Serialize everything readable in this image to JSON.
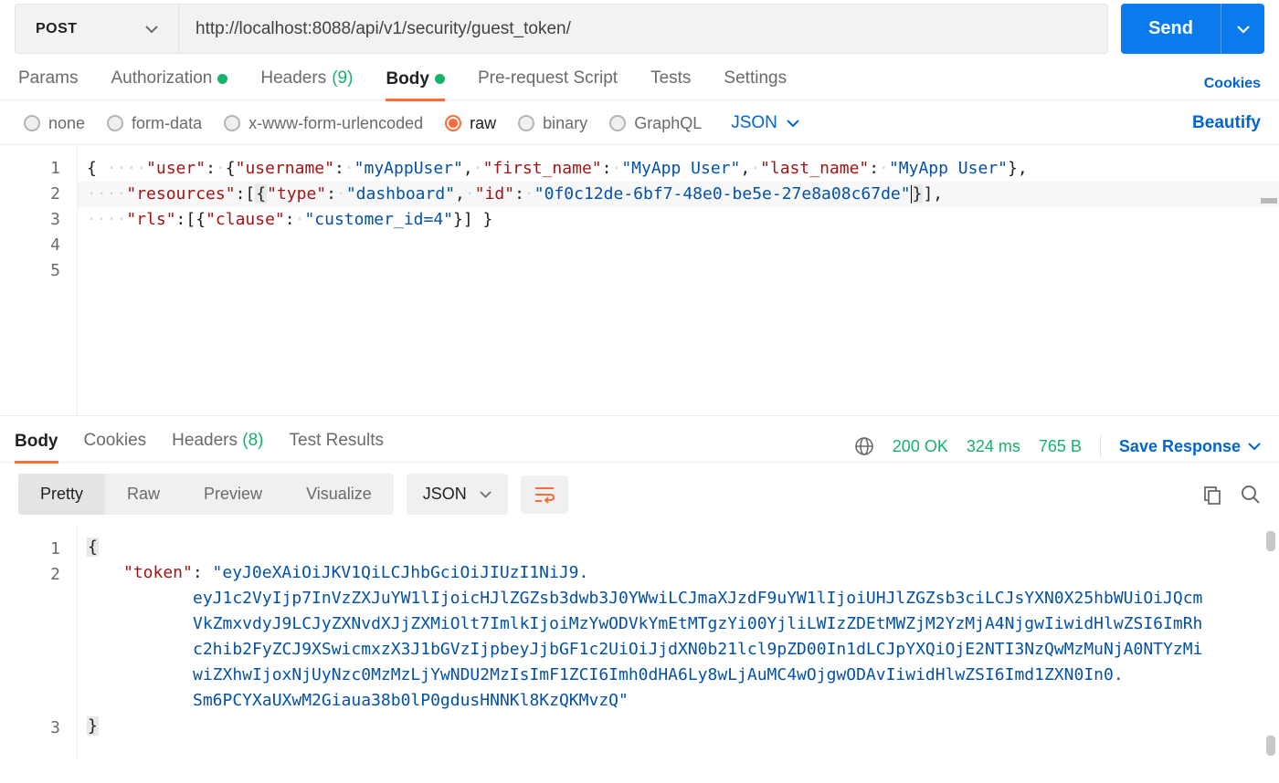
{
  "request": {
    "method": "POST",
    "url": "http://localhost:8088/api/v1/security/guest_token/",
    "send_label": "Send"
  },
  "tabs": {
    "params": "Params",
    "authorization": "Authorization",
    "headers": "Headers",
    "headers_count": "(9)",
    "body": "Body",
    "prerequest": "Pre-request Script",
    "tests": "Tests",
    "settings": "Settings",
    "cookies_link": "Cookies"
  },
  "body_type": {
    "none": "none",
    "formdata": "form-data",
    "xform": "x-www-form-urlencoded",
    "raw": "raw",
    "binary": "binary",
    "graphql": "GraphQL",
    "lang": "JSON",
    "beautify": "Beautify"
  },
  "request_body": {
    "lines": [
      "1",
      "2",
      "3",
      "4",
      "5"
    ],
    "l2": {
      "k_user": "\"user\"",
      "k_username": "\"username\"",
      "v_username": "\"myAppUser\"",
      "k_first": "\"first_name\"",
      "v_first": "\"MyApp User\"",
      "k_last": "\"last_name\"",
      "v_last": "\"MyApp User\""
    },
    "l3": {
      "k_resources": "\"resources\"",
      "k_type": "\"type\"",
      "v_type": "\"dashboard\"",
      "k_id": "\"id\"",
      "v_id": "\"0f0c12de-6bf7-48e0-be5e-27e8a08c67de\""
    },
    "l4": {
      "k_rls": "\"rls\"",
      "k_clause": "\"clause\"",
      "v_clause": "\"customer_id=4\""
    }
  },
  "response": {
    "tabs": {
      "body": "Body",
      "cookies": "Cookies",
      "headers": "Headers",
      "headers_count": "(8)",
      "test": "Test Results"
    },
    "status": "200 OK",
    "time": "324 ms",
    "size": "765 B",
    "save": "Save Response",
    "fmt": {
      "pretty": "Pretty",
      "raw": "Raw",
      "preview": "Preview",
      "visualize": "Visualize",
      "lang": "JSON"
    },
    "lines": [
      "1",
      "2",
      "3"
    ],
    "body": {
      "k_token": "\"token\"",
      "v_token_1": "\"eyJ0eXAiOiJKV1QiLCJhbGciOiJIUzI1NiJ9.",
      "v_token_2": "eyJ1c2VyIjp7InVzZXJuYW1lIjoicHJlZGZsb3dwb3J0YWwiLCJmaXJzdF9uYW1lIjoiUHJlZGZsb3ciLCJsYXN0X25hbWUiOiJQcm",
      "v_token_3": "VkZmxvdyJ9LCJyZXNvdXJjZXMiOlt7ImlkIjoiMzYwODVkYmEtMTgzYi00YjliLWIzZDEtMWZjM2YzMjA4NjgwIiwidHlwZSI6ImRh",
      "v_token_4": "c2hib2FyZCJ9XSwicmxzX3J1bGVzIjpbeyJjbGF1c2UiOiJjdXN0b21lcl9pZD00In1dLCJpYXQiOjE2NTI3NzQwMzMuNjA0NTYzMi",
      "v_token_5": "wiZXhwIjoxNjUyNzc0MzMzLjYwNDU2MzIsImF1ZCI6Imh0dHA6Ly8wLjAuMC4wOjgwODAvIiwidHlwZSI6Imd1ZXN0In0.",
      "v_token_6": "Sm6PCYXaUXwM2Giaua38b0lP0gdusHNNKl8KzQKMvzQ\""
    }
  }
}
